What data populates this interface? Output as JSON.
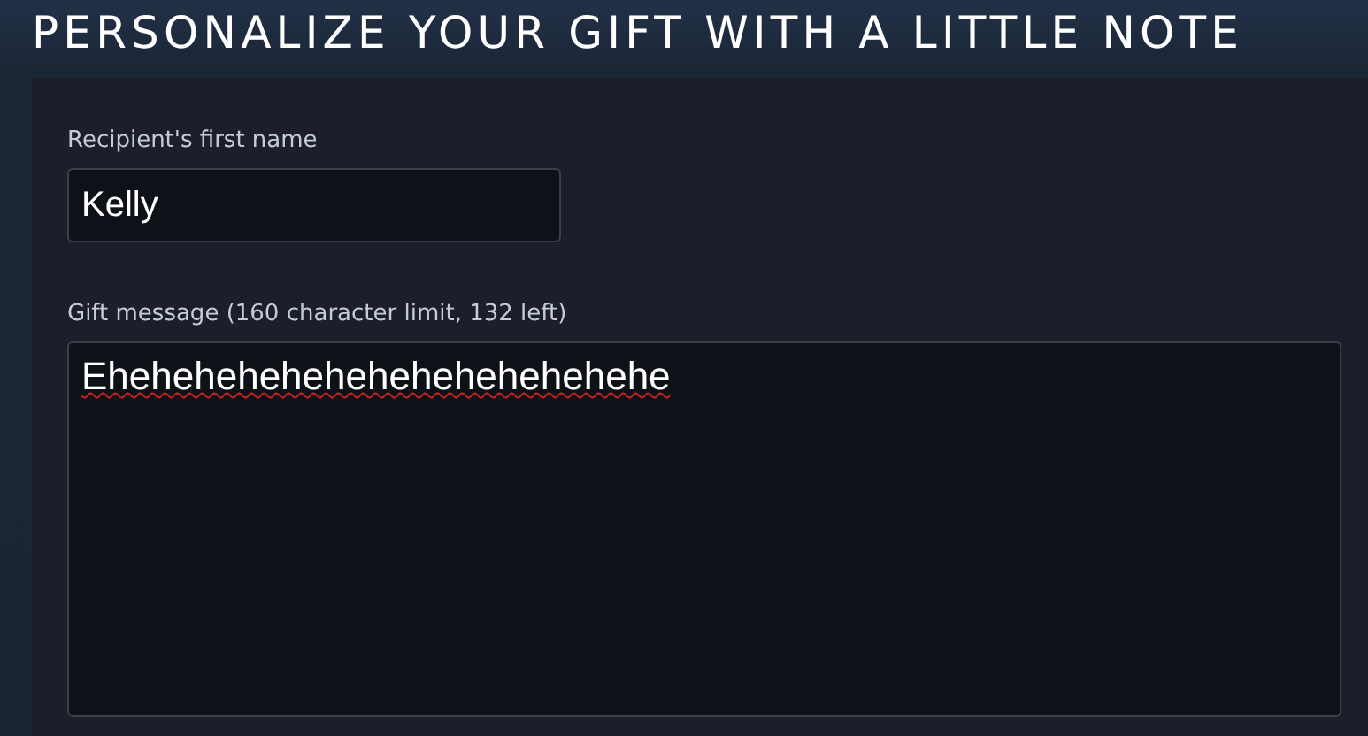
{
  "heading": "PERSONALIZE YOUR GIFT WITH A LITTLE NOTE",
  "recipient": {
    "label": "Recipient's first name",
    "value": "Kelly"
  },
  "message": {
    "label": "Gift message (160 character limit, 132 left)",
    "value": "Ehehehehehehehehehehehehehe"
  }
}
